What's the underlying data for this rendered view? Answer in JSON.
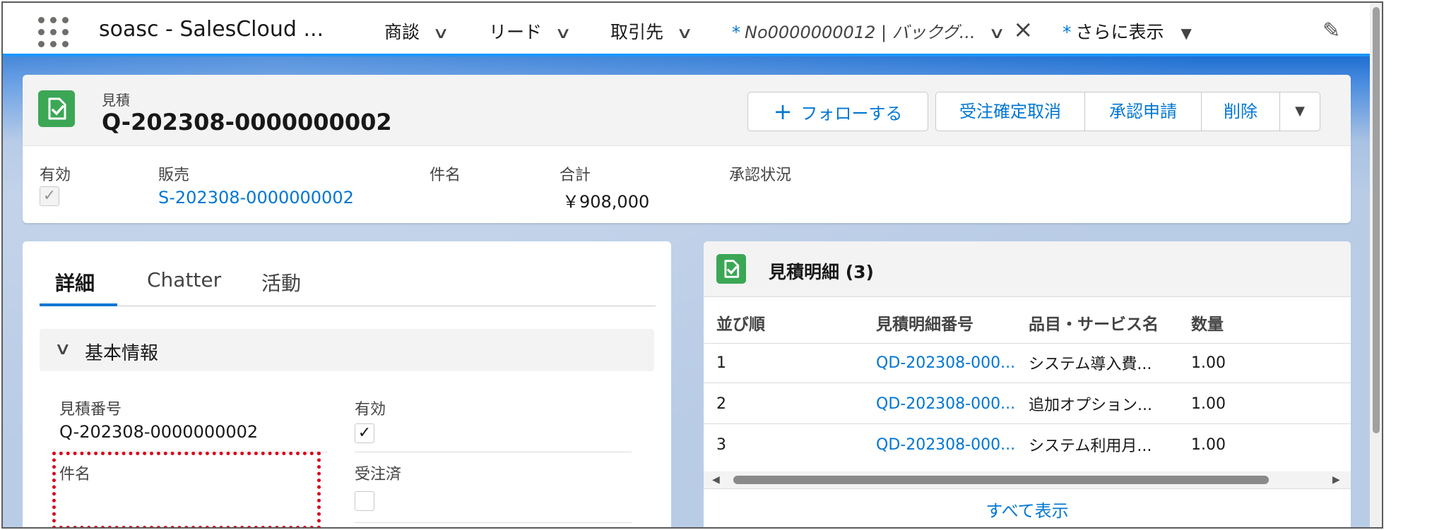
{
  "nav": {
    "app_name": "soasc - SalesCloud ...",
    "items": [
      {
        "label": "商談"
      },
      {
        "label": "リード"
      },
      {
        "label": "取引先"
      }
    ],
    "active_tab": {
      "label": "No0000000012 | バックグ..."
    },
    "more": {
      "label": "さらに表示"
    },
    "icons": [
      "app-launcher-icon",
      "chevron-down-icon",
      "close-icon",
      "caret-down-icon",
      "pencil-icon"
    ]
  },
  "header": {
    "object_label": "見積",
    "record_title": "Q-202308-0000000002",
    "buttons": {
      "follow": "フォローする",
      "cancel_order": "受注確定取消",
      "approval": "承認申請",
      "delete": "削除"
    }
  },
  "highlights": {
    "fields": [
      {
        "label": "有効",
        "checked": true
      },
      {
        "label": "販売",
        "value": "S-202308-0000000002"
      },
      {
        "label": "件名",
        "value": ""
      },
      {
        "label": "合計",
        "value": "￥908,000"
      },
      {
        "label": "承認状況",
        "value": ""
      }
    ]
  },
  "detail": {
    "tabs": [
      "詳細",
      "Chatter",
      "活動"
    ],
    "active_tab": "詳細",
    "section_title": "基本情報",
    "fields": {
      "quote_number_label": "見積番号",
      "quote_number_value": "Q-202308-0000000002",
      "active_label": "有効",
      "active_checked": true,
      "subject_label": "件名",
      "subject_value": "",
      "ordered_label": "受注済",
      "ordered_checked": false
    }
  },
  "related": {
    "title": "見積明細 (3)",
    "columns": [
      "並び順",
      "見積明細番号",
      "品目・サービス名",
      "数量"
    ],
    "rows": [
      {
        "order": "1",
        "number": "QD-202308-000...",
        "item": "システム導入費...",
        "qty": "1.00"
      },
      {
        "order": "2",
        "number": "QD-202308-000...",
        "item": "追加オプション...",
        "qty": "1.00"
      },
      {
        "order": "3",
        "number": "QD-202308-000...",
        "item": "システム利用月...",
        "qty": "1.00"
      }
    ],
    "view_all": "すべて表示"
  },
  "colors": {
    "brand_blue": "#0176d3",
    "nav_accent": "#1b96ff",
    "object_icon": "#3ba755",
    "highlight_box": "#d9001b"
  }
}
